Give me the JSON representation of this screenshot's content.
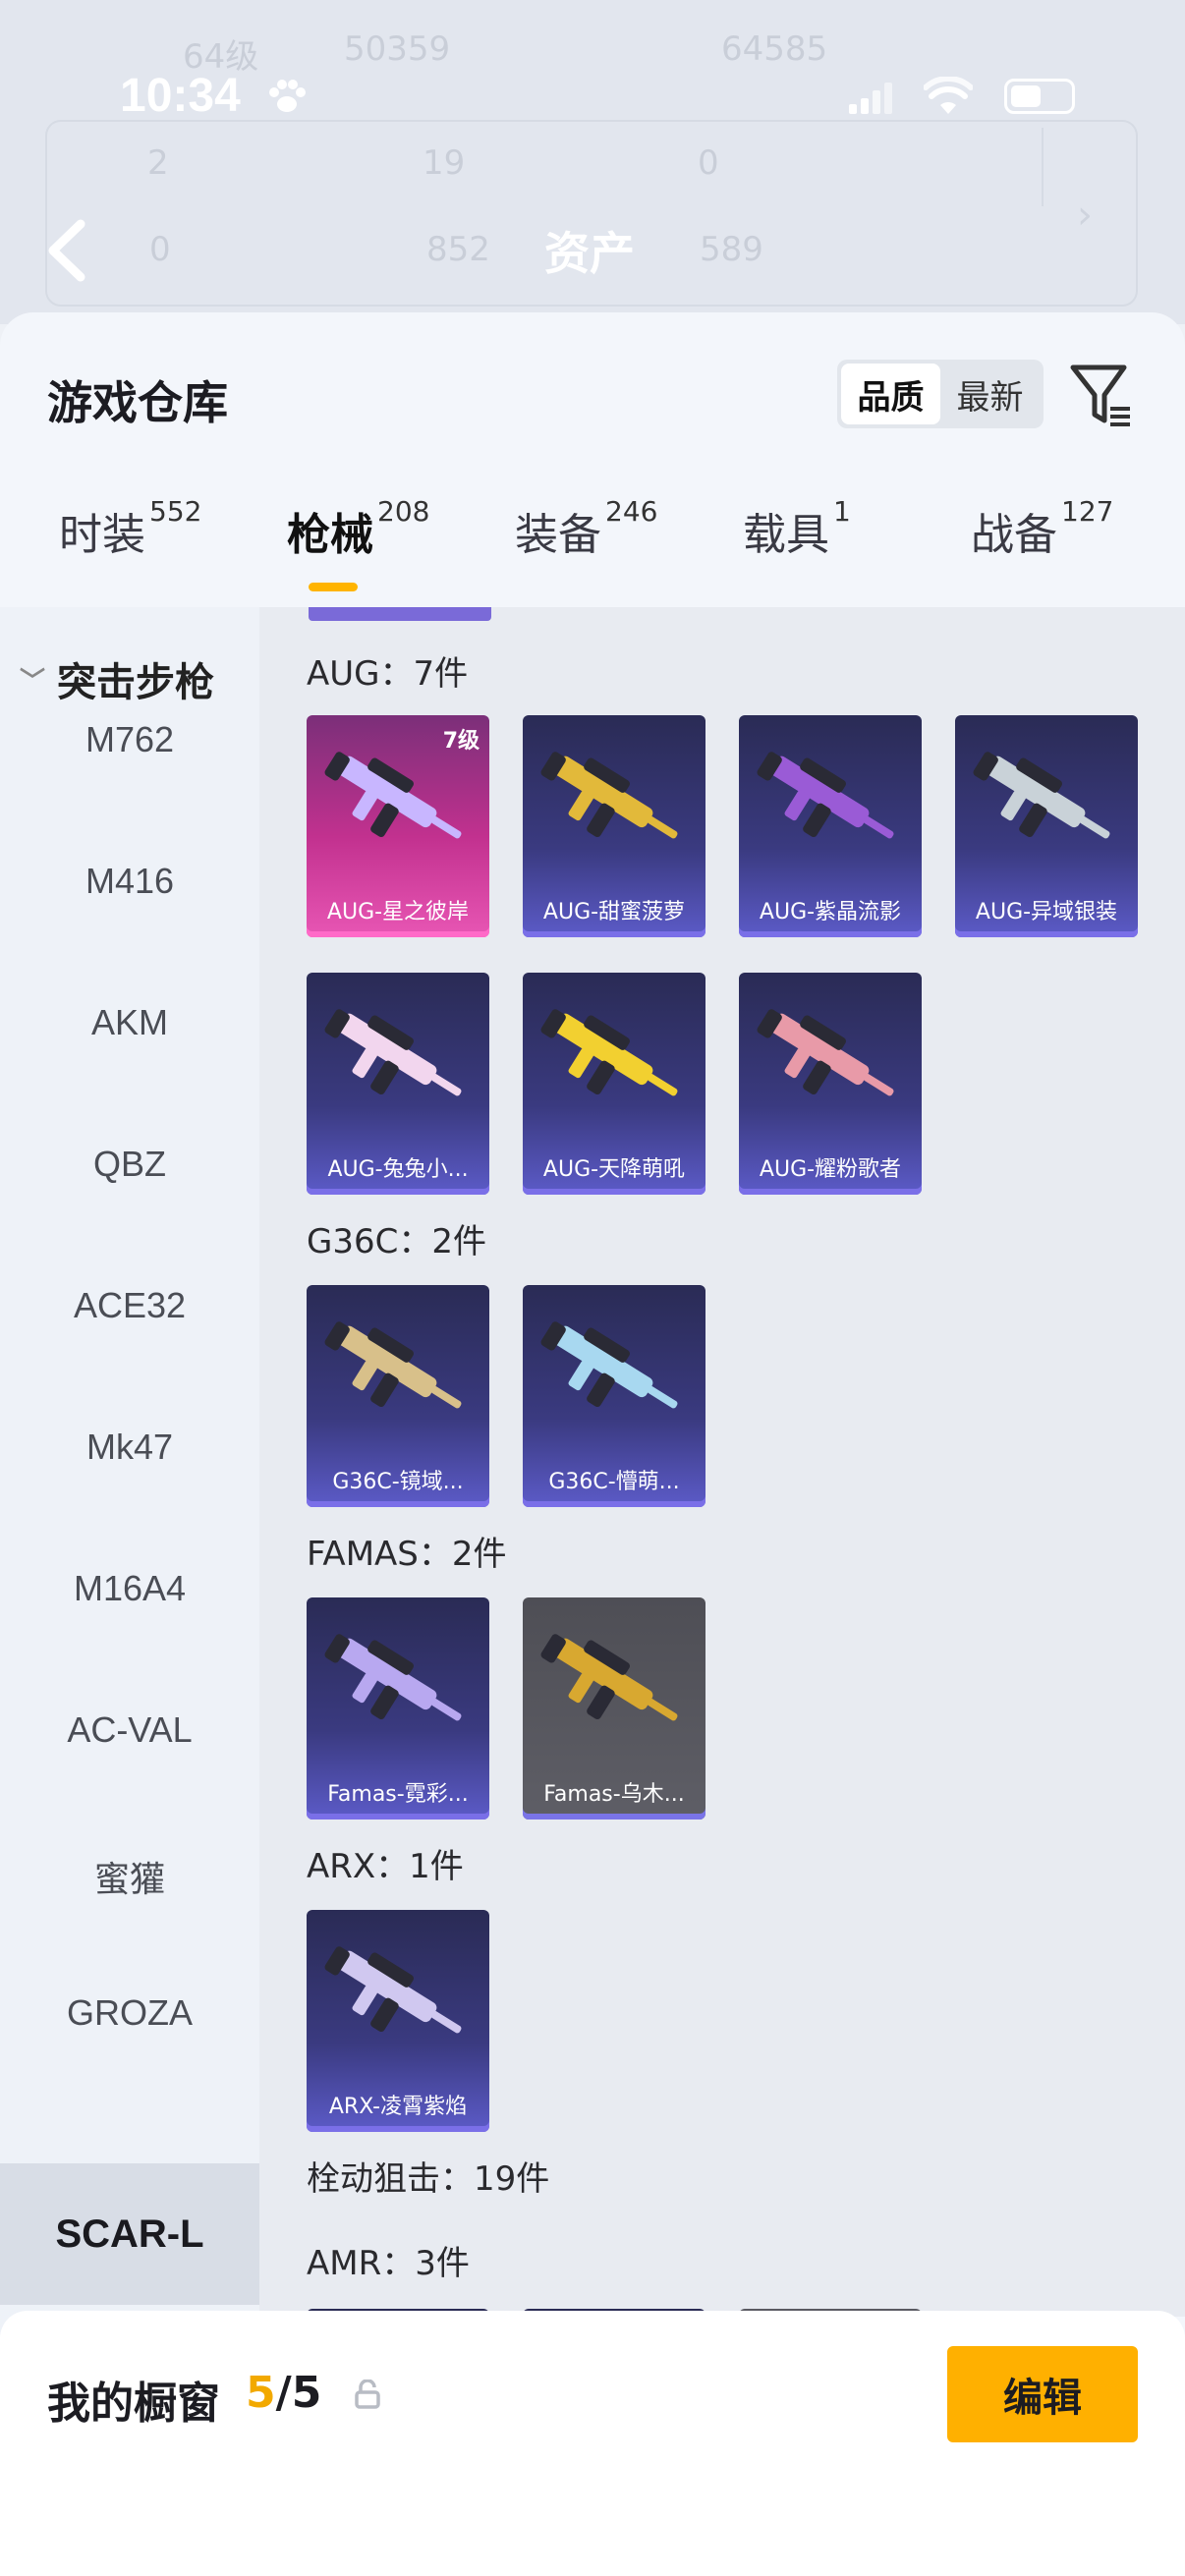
{
  "status_bar": {
    "time": "10:34"
  },
  "header": {
    "title": "资产",
    "ghost_texts": [
      "64级",
      "50359",
      "64585",
      "2",
      "19",
      "0",
      "0",
      "852",
      "589"
    ]
  },
  "warehouse": {
    "title": "游戏仓库",
    "sort_options": [
      "品质",
      "最新"
    ],
    "selected_sort": "品质",
    "tabs": [
      {
        "label": "时装",
        "count": "552"
      },
      {
        "label": "枪械",
        "count": "208"
      },
      {
        "label": "装备",
        "count": "246"
      },
      {
        "label": "载具",
        "count": "1"
      },
      {
        "label": "战备",
        "count": "127"
      }
    ],
    "active_tab": "枪械"
  },
  "sidebar": {
    "category": "突击步枪",
    "items": [
      "M762",
      "M416",
      "AKM",
      "QBZ",
      "ACE32",
      "Mk47",
      "M16A4",
      "AC-VAL",
      "蜜獾",
      "GROZA"
    ],
    "selected": "SCAR-L"
  },
  "groups": [
    {
      "title": "AUG：7件",
      "items": [
        {
          "name": "AUG-星之彼岸",
          "level": "7级",
          "style": "pink",
          "gun_color": "#c8b6ff"
        },
        {
          "name": "AUG-甜蜜菠萝",
          "style": "purple",
          "gun_color": "#e2b93a"
        },
        {
          "name": "AUG-紫晶流影",
          "style": "purple",
          "gun_color": "#9a5bd6"
        },
        {
          "name": "AUG-异域银装",
          "style": "purple",
          "gun_color": "#c9d2d8"
        },
        {
          "name": "AUG-兔兔小...",
          "style": "purple",
          "gun_color": "#f2d6ee"
        },
        {
          "name": "AUG-天降萌吼",
          "style": "purple",
          "gun_color": "#f2d030"
        },
        {
          "name": "AUG-耀粉歌者",
          "style": "purple",
          "gun_color": "#e89aa8"
        }
      ]
    },
    {
      "title": "G36C：2件",
      "items": [
        {
          "name": "G36C-镜域...",
          "style": "purple",
          "gun_color": "#d8c08a"
        },
        {
          "name": "G36C-懵萌...",
          "style": "purple",
          "gun_color": "#a8d8f0"
        }
      ]
    },
    {
      "title": "FAMAS：2件",
      "items": [
        {
          "name": "Famas-霓彩...",
          "style": "purple",
          "gun_color": "#b8a8f0"
        },
        {
          "name": "Famas-乌木...",
          "style": "grey",
          "gun_color": "#d8a830"
        }
      ]
    },
    {
      "title": "ARX：1件",
      "items": [
        {
          "name": "ARX-凌霄紫焰",
          "style": "purple",
          "gun_color": "#d0c8f0"
        }
      ]
    },
    {
      "title": "栓动狙击：19件",
      "items": []
    },
    {
      "title": "AMR：3件",
      "items": []
    }
  ],
  "showcase": {
    "label": "我的橱窗",
    "current": "5",
    "separator": "/",
    "total": "5",
    "edit_label": "编辑"
  },
  "colors": {
    "accent": "#ffb000",
    "purple_card": "#3a3a80",
    "pink_card": "#c2318f"
  },
  "icons": [
    "back-arrow-icon",
    "filter-icon",
    "share-icon",
    "lock-icon",
    "chevron-down-icon"
  ]
}
